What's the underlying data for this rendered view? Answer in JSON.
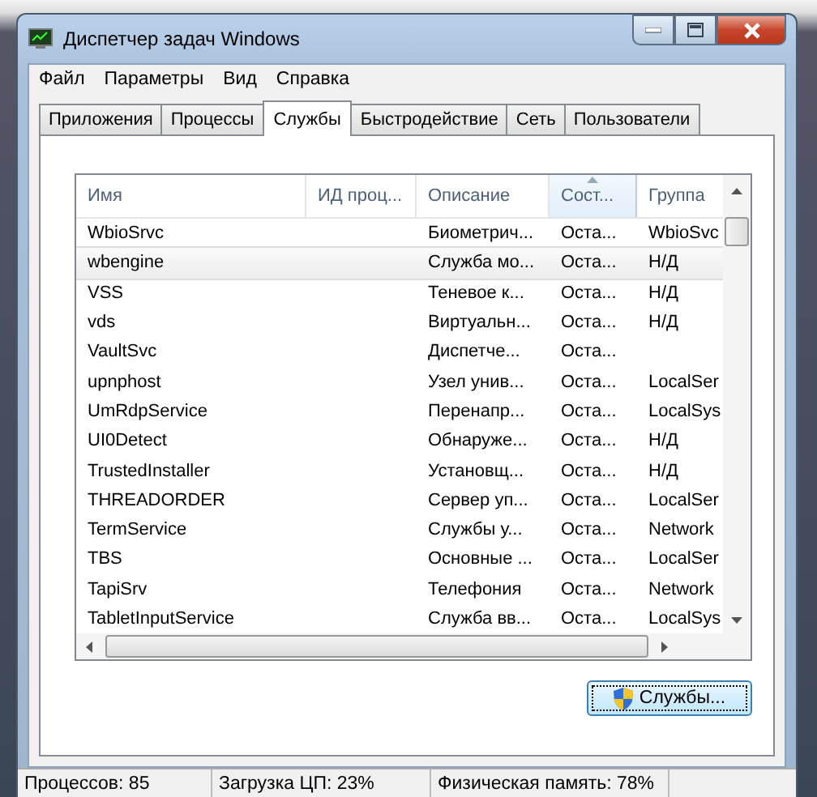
{
  "window": {
    "title": "Диспетчер задач Windows"
  },
  "menu": [
    "Файл",
    "Параметры",
    "Вид",
    "Справка"
  ],
  "tabs": [
    {
      "label": "Приложения",
      "selected": false
    },
    {
      "label": "Процессы",
      "selected": false
    },
    {
      "label": "Службы",
      "selected": true
    },
    {
      "label": "Быстродействие",
      "selected": false
    },
    {
      "label": "Сеть",
      "selected": false
    },
    {
      "label": "Пользователи",
      "selected": false
    }
  ],
  "table": {
    "columns": [
      {
        "label": "Имя",
        "sorted": false
      },
      {
        "label": "ИД проц...",
        "sorted": false
      },
      {
        "label": "Описание",
        "sorted": false
      },
      {
        "label": "Сост...",
        "sorted": true
      },
      {
        "label": "Группа",
        "sorted": false
      }
    ],
    "rows": [
      {
        "cells": [
          "WbioSrvc",
          "",
          "Биометрич...",
          "Оста...",
          "WbioSvc"
        ],
        "selected": false
      },
      {
        "cells": [
          "wbengine",
          "",
          "Служба мо...",
          "Оста...",
          "Н/Д"
        ],
        "selected": true
      },
      {
        "cells": [
          "VSS",
          "",
          "Теневое к...",
          "Оста...",
          "Н/Д"
        ],
        "selected": false
      },
      {
        "cells": [
          "vds",
          "",
          "Виртуальн...",
          "Оста...",
          "Н/Д"
        ],
        "selected": false
      },
      {
        "cells": [
          "VaultSvc",
          "",
          "Диспетче...",
          "Оста...",
          ""
        ],
        "selected": false
      },
      {
        "cells": [
          "upnphost",
          "",
          "Узел унив...",
          "Оста...",
          "LocalSer"
        ],
        "selected": false
      },
      {
        "cells": [
          "UmRdpService",
          "",
          "Перенапр...",
          "Оста...",
          "LocalSys"
        ],
        "selected": false
      },
      {
        "cells": [
          "UI0Detect",
          "",
          "Обнаруже...",
          "Оста...",
          "Н/Д"
        ],
        "selected": false
      },
      {
        "cells": [
          "TrustedInstaller",
          "",
          "Установщ...",
          "Оста...",
          "Н/Д"
        ],
        "selected": false
      },
      {
        "cells": [
          "THREADORDER",
          "",
          "Сервер уп...",
          "Оста...",
          "LocalSer"
        ],
        "selected": false
      },
      {
        "cells": [
          "TermService",
          "",
          "Службы у...",
          "Оста...",
          "Network"
        ],
        "selected": false
      },
      {
        "cells": [
          "TBS",
          "",
          "Основные ...",
          "Оста...",
          "LocalSer"
        ],
        "selected": false
      },
      {
        "cells": [
          "TapiSrv",
          "",
          "Телефония",
          "Оста...",
          "Network"
        ],
        "selected": false
      },
      {
        "cells": [
          "TabletInputService",
          "",
          "Служба вв...",
          "Оста...",
          "LocalSys"
        ],
        "selected": false
      }
    ]
  },
  "services_button": {
    "label": "Службы...",
    "focused": true
  },
  "status_bar": [
    "Процессов: 85",
    "Загрузка ЦП: 23%",
    "Физическая память: 78%"
  ]
}
